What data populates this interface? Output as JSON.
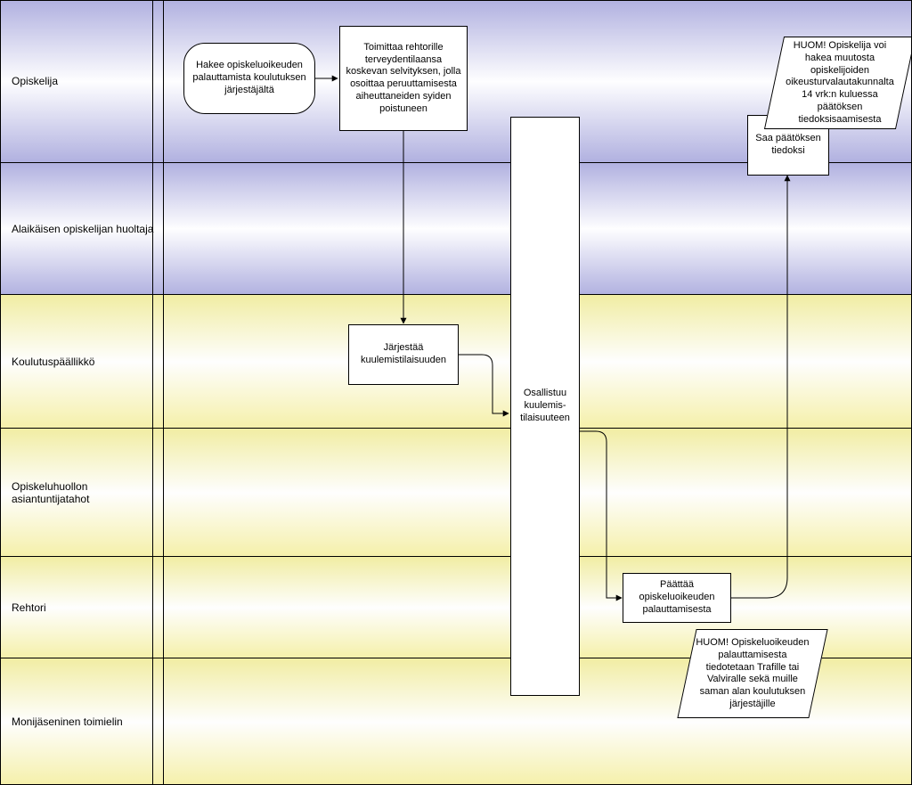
{
  "lanes": [
    {
      "id": "opiskelija",
      "label": "Opiskelija"
    },
    {
      "id": "huoltaja",
      "label": "Alaikäisen opiskelijan huoltaja"
    },
    {
      "id": "koulutuspaallikko",
      "label": "Koulutuspäällikkö"
    },
    {
      "id": "opiskeluhuolto",
      "label": "Opiskeluhuollon asiantuntijatahot"
    },
    {
      "id": "rehtori",
      "label": "Rehtori"
    },
    {
      "id": "monijaseninen",
      "label": "Monijäseninen toimielin"
    }
  ],
  "nodes": {
    "start": "Hakee opiskeluoikeuden palauttamista koulutuksen järjestäjältä",
    "toim": "Toimittaa rehtorille terveydentilaansa koskevan selvityksen, jolla osoittaa peruuttamisesta aiheuttaneiden syiden poistuneen",
    "jarj": "Järjestää kuulemistilaisuuden",
    "osall": "Osallistuu kuulemis-tilaisuuteen",
    "paattaa": "Päättää opiskeluoikeuden palauttamisesta",
    "saa": "Saa päätöksen tiedoksi",
    "note1": "HUOM! Opiskelija voi hakea muutosta opiskelijoiden oikeusturvalautakunnalta 14 vrk:n kuluessa päätöksen tiedoksisaamisesta",
    "note2": "HUOM! Opiskeluoikeuden palauttamisesta tiedotetaan Trafille tai Valviralle sekä muille saman alan koulutuksen järjestäjille"
  }
}
